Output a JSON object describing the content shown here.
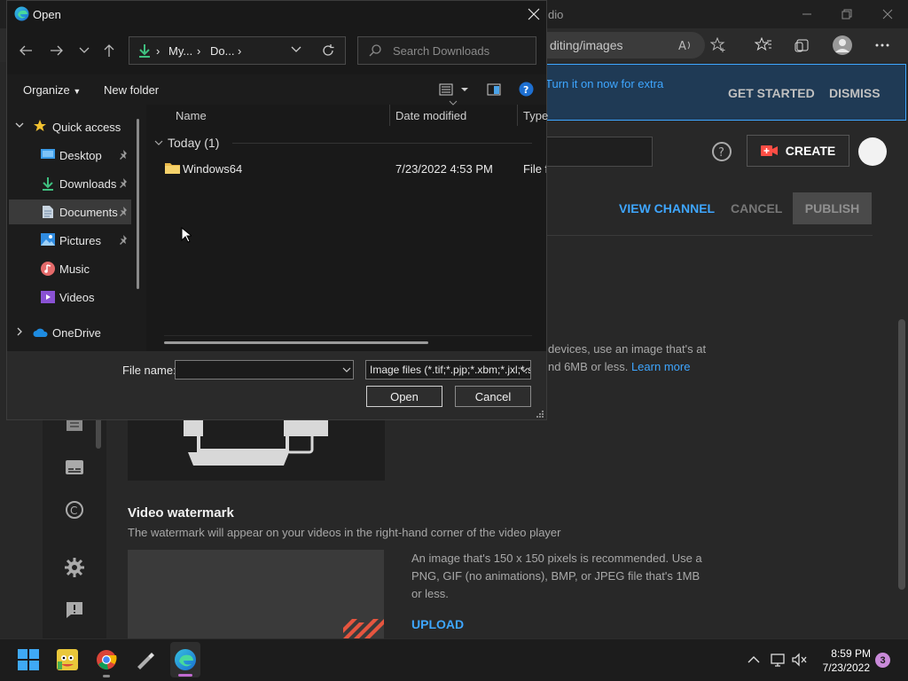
{
  "browser": {
    "title_fragment": "dio",
    "address_fragment": "diting/images"
  },
  "youtube": {
    "notice": {
      "text": "Turn it on now for extra",
      "get_started": "GET STARTED",
      "dismiss": "DISMISS"
    },
    "header": {
      "create": "CREATE"
    },
    "actions": {
      "view_channel": "VIEW CHANNEL",
      "cancel": "CANCEL",
      "publish": "PUBLISH"
    },
    "banner": {
      "desc_line1": "devices, use an image that's at",
      "desc_line2": "nd 6MB or less.",
      "learn_more": "Learn more"
    },
    "watermark": {
      "title": "Video watermark",
      "desc": "The watermark will appear on your videos in the right-hand corner of the video player",
      "info": "An image that's 150 x 150 pixels is recommended. Use a PNG, GIF (no animations), BMP, or JPEG file that's 1MB or less.",
      "upload": "UPLOAD"
    }
  },
  "dialog": {
    "title": "Open",
    "breadcrumbs": [
      "My...",
      "Do..."
    ],
    "search_placeholder": "Search Downloads",
    "organize": "Organize",
    "new_folder": "New folder",
    "nav": {
      "quick_access": "Quick access",
      "items": [
        {
          "label": "Desktop",
          "pinned": true
        },
        {
          "label": "Downloads",
          "pinned": true
        },
        {
          "label": "Documents",
          "pinned": true,
          "selected": true
        },
        {
          "label": "Pictures",
          "pinned": true
        },
        {
          "label": "Music"
        },
        {
          "label": "Videos"
        }
      ],
      "onedrive": "OneDrive"
    },
    "columns": {
      "name": "Name",
      "date": "Date modified",
      "type": "Type"
    },
    "group": "Today (1)",
    "files": [
      {
        "name": "Windows64",
        "date": "7/23/2022 4:53 PM",
        "type": "File folder"
      }
    ],
    "file_name_label": "File name:",
    "file_name_value": "",
    "filter": "Image files (*.tif;*.pjp;*.xbm;*.jxl;*.svgz;*.jpg)",
    "open": "Open",
    "cancel": "Cancel"
  },
  "taskbar": {
    "time": "8:59 PM",
    "date": "7/23/2022",
    "notifications": "3"
  },
  "colors": {
    "accent_blue": "#3ea6ff",
    "create_red": "#ff4e45",
    "edge_active": "#c06ad0"
  }
}
